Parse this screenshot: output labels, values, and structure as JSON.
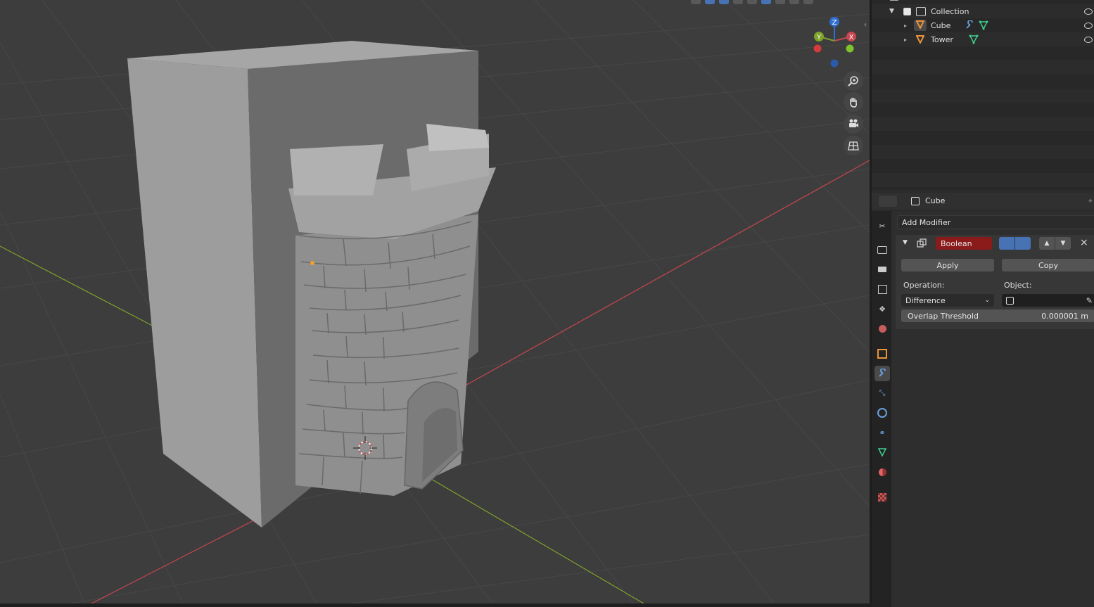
{
  "outliner": {
    "rows": [
      {
        "label": "Collection",
        "depth": 1
      },
      {
        "label": "Cube",
        "depth": 2
      },
      {
        "label": "Tower",
        "depth": 2
      }
    ]
  },
  "gizmo": {
    "x_label": "X",
    "y_label": "Y",
    "z_label": "Z"
  },
  "properties": {
    "object_name": "Cube",
    "add_modifier_label": "Add Modifier",
    "modifier_name": "Boolean",
    "apply_label": "Apply",
    "copy_label": "Copy",
    "operation_label": "Operation:",
    "object_label": "Object:",
    "operation_value": "Difference",
    "overlap_threshold_label": "Overlap Threshold",
    "overlap_threshold_value": "0.000001 m"
  },
  "colors": {
    "viewport_bg": "#3d3d3d",
    "grid": "#4a4a4a",
    "x_axis": "#c8464f",
    "y_axis": "#7ea32b",
    "modifier_name_bg": "#8b1a1a",
    "accent_blue": "#4772b3"
  },
  "icons": [
    "zoom-icon",
    "hand-icon",
    "camera-icon",
    "grid-icon",
    "wrench-icon",
    "cube-icon",
    "mesh-icon",
    "eye-icon",
    "checkbox-icon",
    "eyedropper-icon"
  ]
}
